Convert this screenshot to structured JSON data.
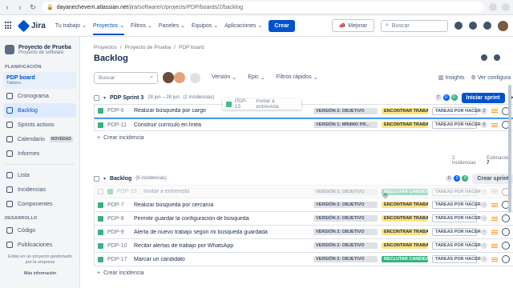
{
  "browser": {
    "url_main": "dayanecheverri.atlassian.net",
    "url_path": "/jira/software/c/projects/PDP/boards/2/backlog"
  },
  "topnav": {
    "logo": "Jira",
    "menus": [
      "Tu trabajo",
      "Proyectos",
      "Filtros",
      "Paneles",
      "Equipos",
      "Aplicaciones"
    ],
    "create": "Crear",
    "improve": "Mejorar",
    "search_placeholder": "Buscar"
  },
  "sidebar": {
    "project_name": "Proyecto de Prueba",
    "project_type": "Proyecto de software",
    "planning_title": "PLANIFICACIÓN",
    "board_name": "PDP board",
    "board_sub": "Tablero",
    "items": [
      {
        "label": "Cronograma"
      },
      {
        "label": "Backlog"
      },
      {
        "label": "Sprints activos"
      },
      {
        "label": "Calendario",
        "badge": "NOVEDAD"
      },
      {
        "label": "Informes"
      },
      {
        "label": "Lista"
      },
      {
        "label": "Incidencias"
      },
      {
        "label": "Componentes"
      }
    ],
    "dev_title": "DESARROLLO",
    "dev_items": [
      {
        "label": "Código"
      },
      {
        "label": "Publicaciones"
      }
    ],
    "footer": "Estás en un proyecto gestionado por la empresa",
    "more_info": "Más información"
  },
  "main": {
    "breadcrumbs": [
      "Proyectos",
      "/",
      "Proyecto de Prueba",
      "/",
      "PDP board"
    ],
    "title": "Backlog",
    "search_placeholder": "Buscar",
    "filters": [
      "Versión",
      "Epic",
      "Filtros rápidos"
    ],
    "insights": "Insights",
    "view_config": "Ver configura"
  },
  "sprint": {
    "name": "PDP Sprint 3",
    "dates": "28 jun – 28 jun",
    "issues_count": "(2 incidencias)",
    "counts": [
      "7",
      "0",
      "0"
    ],
    "start_button": "Iniciar sprint",
    "rows": [
      {
        "key": "PDP-6",
        "summary": "Realizar búsqueda por cargo",
        "epic": "VERSIÓN 2: OBJETIVO",
        "status_label": "ENCONTRAR TRABAJO",
        "workflow": "TAREAS POR HACER",
        "points": "2"
      },
      {
        "key": "PDP-11",
        "summary": "Construir currículo en línea",
        "epic": "VERSIÓN 1: MÍNIMO PR...",
        "status_label": "ENCONTRAR TRABAJO",
        "workflow": "TAREAS POR HACER",
        "points": "5"
      }
    ],
    "create_issue": "Crear incidencia",
    "footer_issues": "2 incidencias",
    "footer_estimate_label": "Estimación",
    "footer_estimate_value": "7"
  },
  "drag_preview": {
    "key": "PDP-15",
    "summary": "Invitar a entrevista"
  },
  "backlog": {
    "name": "Backlog",
    "issues_count": "(6 incidencias)",
    "counts": [
      "0",
      "0",
      "0"
    ],
    "create_sprint": "Crear sprint",
    "rows": [
      {
        "key": "PDP-15",
        "summary": "Invitar a entrevista",
        "epic": "VERSIÓN 2: OBJETIVO",
        "status_label": "RECLUTAR CANDIDATO",
        "workflow": "TAREAS POR HACER",
        "points": "-",
        "ghost": true
      },
      {
        "key": "PDP-7",
        "summary": "Realizar búsqueda por cercanía",
        "epic": "VERSIÓN 2: OBJETIVO",
        "status_label": "ENCONTRAR TRABAJO",
        "workflow": "TAREAS POR HACER",
        "points": "-"
      },
      {
        "key": "PDP-8",
        "summary": "Permitir guardar la configuración de búsqueda",
        "epic": "VERSIÓN 2: OBJETIVO",
        "status_label": "ENCONTRAR TRABAJO",
        "workflow": "TAREAS POR HACER",
        "points": "-"
      },
      {
        "key": "PDP-9",
        "summary": "Alerta de nuevo trabajo según mi búsqueda guardada",
        "epic": "VERSIÓN 2: OBJETIVO",
        "status_label": "ENCONTRAR TRABAJO",
        "workflow": "TAREAS POR HACER",
        "points": "-"
      },
      {
        "key": "PDP-10",
        "summary": "Recibir alertas de trabajo por WhatsApp",
        "epic": "VERSIÓN 2: OBJETIVO",
        "status_label": "ENCONTRAR TRABAJO",
        "workflow": "TAREAS POR HACER",
        "points": "-"
      },
      {
        "key": "PDP-17",
        "summary": "Marcar un candidato",
        "epic": "VERSIÓN 2: OBJETIVO",
        "status_label": "RECLUTAR CANDIDATO",
        "workflow": "TAREAS POR HACER",
        "points": "-"
      }
    ],
    "create_issue": "Crear incidencia"
  },
  "colors": {
    "accent": "#0052cc",
    "find_job": "#ffe380",
    "recruit": "#36b37e"
  }
}
